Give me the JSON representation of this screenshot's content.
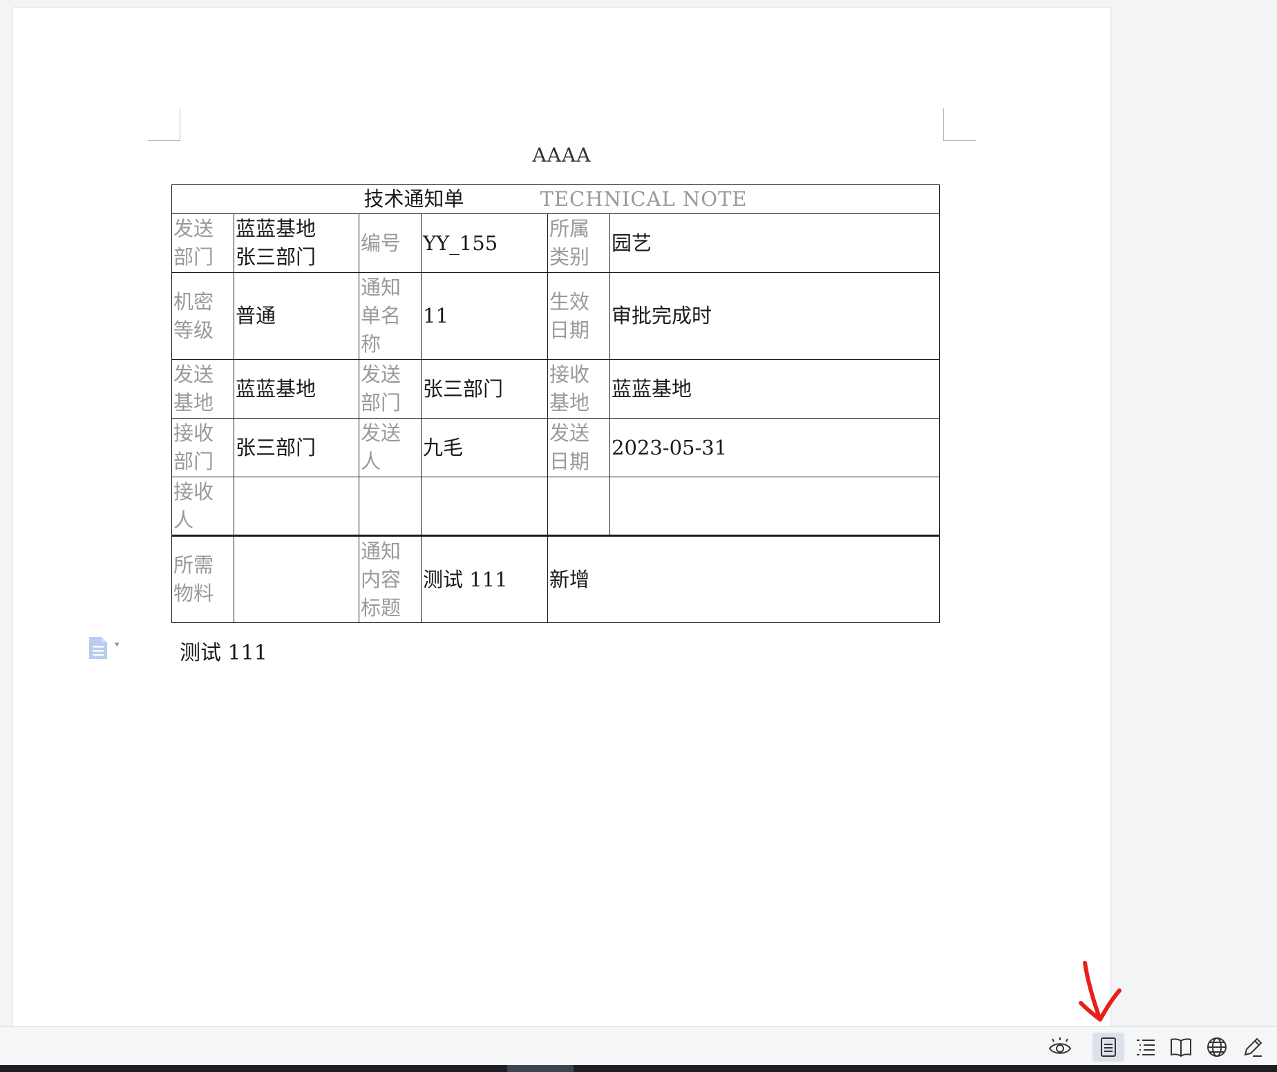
{
  "document": {
    "header": "AAAA",
    "table": {
      "title_cn": "技术通知单",
      "title_en": "TECHNICAL NOTE",
      "rows": [
        [
          {
            "label": "发送\n部门",
            "value": "蓝蓝基地\n张三部门"
          },
          {
            "label": "编号",
            "value": "YY_155"
          },
          {
            "label": "所属\n类别",
            "value": "园艺"
          }
        ],
        [
          {
            "label": "机密\n等级",
            "value": "普通"
          },
          {
            "label": "通知\n单名\n称",
            "value": "11"
          },
          {
            "label": "生效\n日期",
            "value": "审批完成时"
          }
        ],
        [
          {
            "label": "发送\n基地",
            "value": "蓝蓝基地"
          },
          {
            "label": "发送\n部门",
            "value": "张三部门"
          },
          {
            "label": "接收\n基地",
            "value": "蓝蓝基地"
          }
        ],
        [
          {
            "label": "接收\n部门",
            "value": "张三部门"
          },
          {
            "label": "发送\n人",
            "value": "九毛"
          },
          {
            "label": "发送\n日期",
            "value": "2023-05-31"
          }
        ],
        [
          {
            "label": "接收\n人",
            "value": ""
          },
          {
            "label": "",
            "value": ""
          },
          {
            "label": "",
            "value": ""
          }
        ]
      ],
      "last_row": {
        "label_1": "所需\n物料",
        "value_1": "",
        "label_2": "通知\n内容\n标题",
        "value_2": "测试 111",
        "value_3": "新增"
      }
    },
    "paragraph": "测试 111"
  },
  "statusbar": {
    "views": [
      "eye-icon",
      "page-view-icon",
      "outline-icon",
      "book-icon",
      "globe-icon",
      "pen-icon"
    ],
    "active_view": "page-view-icon"
  },
  "colors": {
    "label_gray": "#9a9a9a",
    "annotation_red": "#e8201a",
    "active_bg": "#dde2ea"
  }
}
